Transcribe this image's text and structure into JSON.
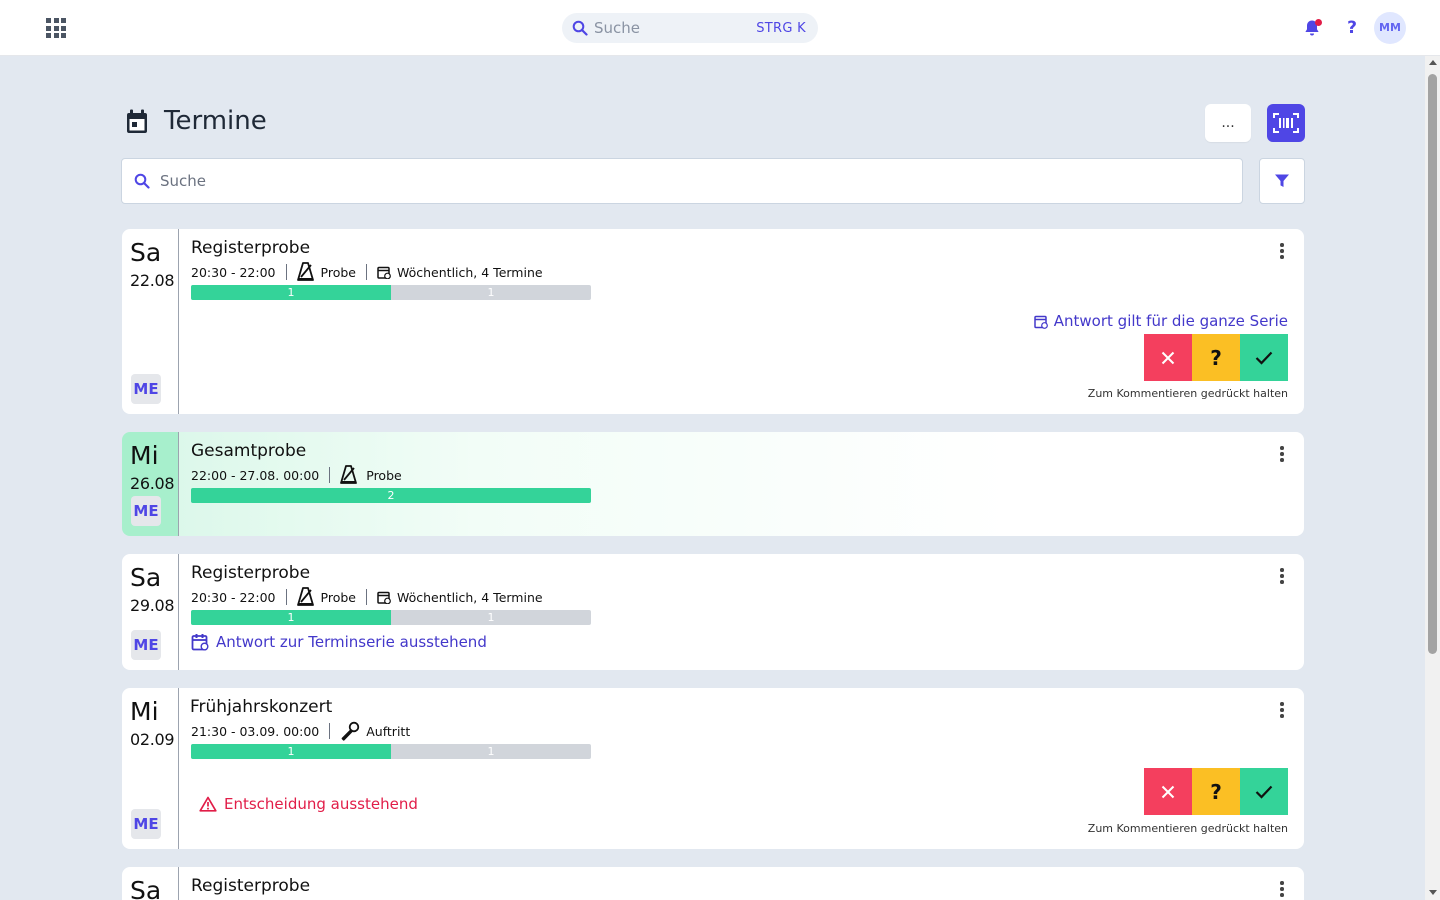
{
  "topbar": {
    "search_placeholder": "Suche",
    "search_shortcut": "STRG K",
    "help_label": "?",
    "avatar_initials": "MM"
  },
  "page": {
    "title": "Termine",
    "more_label": "...",
    "search_placeholder": "Suche"
  },
  "events": [
    {
      "dow": "Sa",
      "date": "22.08",
      "title": "Registerprobe",
      "time": "20:30 - 22:00",
      "type": "Probe",
      "recurrence": "Wöchentlich, 4 Termine",
      "register": "ME",
      "bar_fill_fraction": 0.5,
      "bar_left_count": "1",
      "bar_right_count": "1",
      "series_answer_label": "Antwort gilt für die ganze Serie",
      "maybe_label": "?",
      "hint": "Zum Kommentieren gedrückt halten"
    },
    {
      "dow": "Mi",
      "date": "26.08",
      "title": "Gesamtprobe",
      "time": "22:00 - 27.08. 00:00",
      "type": "Probe",
      "register": "ME",
      "bar_fill_fraction": 1.0,
      "bar_count": "2"
    },
    {
      "dow": "Sa",
      "date": "29.08",
      "title": "Registerprobe",
      "time": "20:30 - 22:00",
      "type": "Probe",
      "recurrence": "Wöchentlich, 4 Termine",
      "register": "ME",
      "bar_fill_fraction": 0.5,
      "bar_left_count": "1",
      "bar_right_count": "1",
      "pending_series_label": "Antwort zur Terminserie ausstehend"
    },
    {
      "dow": "Mi",
      "date": "02.09",
      "title": "Frühjahrskonzert",
      "time": "21:30 - 03.09. 00:00",
      "type": "Auftritt",
      "register": "ME",
      "bar_fill_fraction": 0.5,
      "bar_left_count": "1",
      "bar_right_count": "1",
      "pending_decision_label": "Entscheidung ausstehend",
      "maybe_label": "?",
      "hint": "Zum Kommentieren gedrückt halten"
    },
    {
      "dow": "Sa",
      "title": "Registerprobe"
    }
  ],
  "colors": {
    "accent": "#4f46e5",
    "progress_filled": "#34d399",
    "progress_empty": "#d1d5db",
    "decline": "#f43f5e",
    "maybe": "#fbbf24",
    "accept": "#34d399",
    "warning": "#e11d48",
    "today_highlight": "#a7efcc"
  },
  "icons": {
    "apps": "apps-grid-icon",
    "search": "search-icon",
    "notifications": "bell-icon",
    "help": "help-icon",
    "page": "calendar-icon",
    "scan": "barcode-scan-icon",
    "filter": "filter-icon",
    "rehearsal": "metronome-icon",
    "performance": "microphone-icon",
    "recurrence": "calendar-repeat-icon",
    "decline": "close-icon",
    "accept": "check-icon",
    "warning": "warning-icon",
    "menu": "more-vertical-icon"
  }
}
